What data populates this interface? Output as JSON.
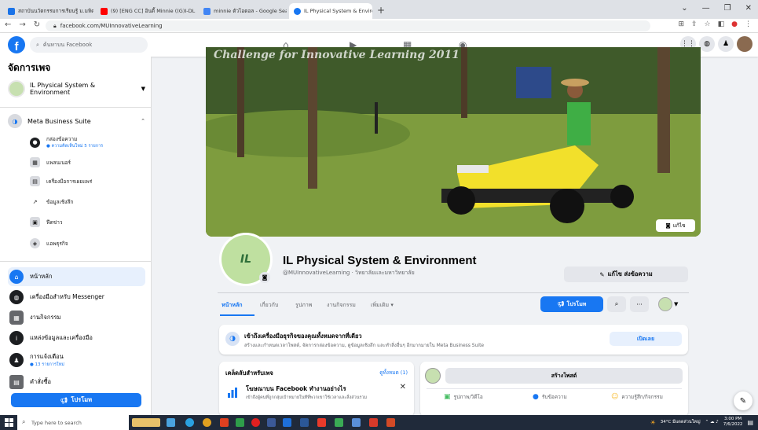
{
  "browser": {
    "tabs": [
      {
        "label": "สถาบันนวัตกรรมการเรียนรู้ ม.มหิดล",
        "color": "#1a73e8"
      },
      {
        "label": "(9) [ENG CC] อินดี้ Minnie ((G)I-DL",
        "color": "#ff0000"
      },
      {
        "label": "minnie ตัวไอดอล - Google Search",
        "color": "#4285f4"
      },
      {
        "label": "IL Physical System & Environment",
        "color": "#1877f2"
      }
    ],
    "new_tab": "+",
    "url": "facebook.com/MUInnovativeLearning"
  },
  "facebook": {
    "search_placeholder": "ค้นหาบน Facebook",
    "sidebar": {
      "title": "จัดการเพจ",
      "page_name": "IL Physical System & Environment",
      "meta_suite": "Meta Business Suite",
      "sub_items": [
        {
          "label": "กล่องข้อความ",
          "note": "● ความคิดเห็นใหม่ 5 รายการ",
          "icon": "inbox-icon"
        },
        {
          "label": "แพลนเนอร์",
          "note": "",
          "icon": "calendar-icon"
        },
        {
          "label": "เครื่องมือการเผยแพร่",
          "note": "",
          "icon": "publishing-icon"
        },
        {
          "label": "ข้อมูลเชิงลึก",
          "note": "",
          "icon": "insights-icon"
        },
        {
          "label": "ฟีดข่าว",
          "note": "",
          "icon": "news-icon"
        },
        {
          "label": "แอพธุรกิจ",
          "note": "",
          "icon": "apps-icon"
        }
      ],
      "main_items": [
        {
          "label": "หน้าหลัก",
          "note": "",
          "icon": "home-icon",
          "selected": true
        },
        {
          "label": "เครื่องมือสำหรับ Messenger",
          "note": "",
          "icon": "messenger-icon"
        },
        {
          "label": "งานกิจกรรม",
          "note": "",
          "icon": "events-icon"
        },
        {
          "label": "แหล่งข้อมูลและเครื่องมือ",
          "note": "",
          "icon": "info-icon"
        },
        {
          "label": "การแจ้งเตือน",
          "note": "● 13 รายการใหม่",
          "icon": "bell-icon"
        },
        {
          "label": "คำสั่งซื้อ",
          "note": "",
          "icon": "orders-icon"
        }
      ],
      "promote": "โปรโมท"
    },
    "cover": {
      "banner_text": "Challenge for Innovative Learning 2011",
      "edit": "แก้ไข"
    },
    "profile": {
      "avatar_text": "IL",
      "name": "IL Physical System & Environment",
      "handle": "@MUInnovativeLearning · วิทยาลัยและมหาวิทยาลัย",
      "edit_info": "แก้ไข ส่งข้อความ"
    },
    "page_tabs": [
      "หน้าหลัก",
      "เกี่ยวกับ",
      "รูปภาพ",
      "งานกิจกรรม",
      "เพิ่มเติม ▾"
    ],
    "actions": {
      "promote": "โปรโมท",
      "search": "⌕",
      "more": "···"
    },
    "tools_card": {
      "title": "เข้าถึงเครื่องมือธุรกิจของคุณทั้งหมดจากที่เดียว",
      "desc": "สร้างและกำหนดเวลาโพสต์, จัดการกล่องข้อความ, ดูข้อมูลเชิงลึก และทำสิ่งอื่นๆ อีกมากมายใน Meta Business Suite",
      "button": "เปิดเลย"
    },
    "recs_card": {
      "title": "เคล็ดลับสำหรับเพจ",
      "see_all": "ดูทั้งหมด (1)",
      "rec_title": "โฆษณาบน Facebook ทำงานอย่างไร",
      "rec_desc": "เข้าถึงผู้คนที่ถูกกลุ่มเป้าหมายในทีที่พวกเขาใช้เวลาและสิ่งส่วนรวม"
    },
    "create_card": {
      "title": "สร้างโพสต์",
      "actions": [
        {
          "label": "รูปภาพ/วิดีโอ",
          "icon": "photo-icon",
          "glyph": "▣",
          "color": "#45bd62"
        },
        {
          "label": "รับข้อความ",
          "icon": "messenger-icon",
          "glyph": "●",
          "color": "#1877f2"
        },
        {
          "label": "ความรู้สึก/กิจกรรม",
          "icon": "feeling-icon",
          "glyph": "☺",
          "color": "#f7b928"
        }
      ]
    }
  },
  "taskbar": {
    "search_placeholder": "Type here to search",
    "weather": "34°C มีแดดส่วนใหญ่",
    "time": "3:00 PM",
    "date": "7/6/2022"
  }
}
